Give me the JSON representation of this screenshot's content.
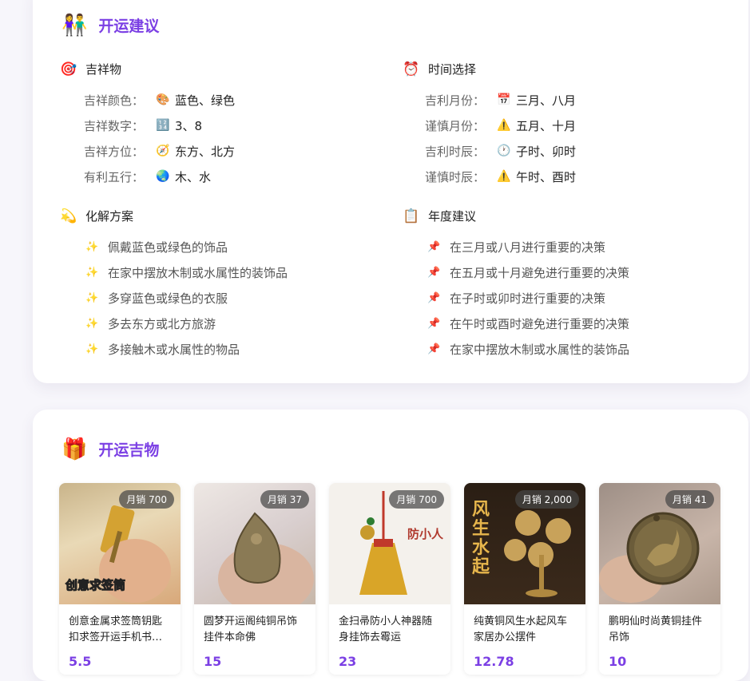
{
  "luck_advice": {
    "title": "开运建议",
    "mascots": {
      "heading": "吉祥物",
      "items": [
        {
          "label": "吉祥颜色：",
          "icon": "palette-icon",
          "value": "蓝色、绿色"
        },
        {
          "label": "吉祥数字：",
          "icon": "numbers-icon",
          "value": "3、8"
        },
        {
          "label": "吉祥方位：",
          "icon": "compass-icon",
          "value": "东方、北方"
        },
        {
          "label": "有利五行：",
          "icon": "globe-icon",
          "value": "木、水"
        }
      ]
    },
    "timing": {
      "heading": "时间选择",
      "items": [
        {
          "label": "吉利月份：",
          "icon": "calendar-icon",
          "value": "三月、八月"
        },
        {
          "label": "谨慎月份：",
          "icon": "warning-icon",
          "value": "五月、十月"
        },
        {
          "label": "吉利时辰：",
          "icon": "clock-icon",
          "value": "子时、卯时"
        },
        {
          "label": "谨慎时辰：",
          "icon": "warning-icon",
          "value": "午时、酉时"
        }
      ]
    },
    "remedies": {
      "heading": "化解方案",
      "items": [
        "佩戴蓝色或绿色的饰品",
        "在家中摆放木制或水属性的装饰品",
        "多穿蓝色或绿色的衣服",
        "多去东方或北方旅游",
        "多接触木或水属性的物品"
      ]
    },
    "yearly": {
      "heading": "年度建议",
      "items": [
        "在三月或八月进行重要的决策",
        "在五月或十月避免进行重要的决策",
        "在子时或卯时进行重要的决策",
        "在午时或酉时避免进行重要的决策",
        "在家中摆放木制或水属性的装饰品"
      ]
    }
  },
  "lucky_items": {
    "title": "开运吉物",
    "products": [
      {
        "sales": "月销 700",
        "name": "创意金属求签筒钥匙扣求签开运手机书…",
        "price": "5.5",
        "thumb_text": "创意求签筒"
      },
      {
        "sales": "月销 37",
        "name": "圆梦开运阁纯铜吊饰挂件本命佛",
        "price": "15",
        "thumb_text": ""
      },
      {
        "sales": "月销 700",
        "name": "金扫帚防小人神器随身挂饰去霉运",
        "price": "23",
        "thumb_text": "防小人"
      },
      {
        "sales": "月销 2,000",
        "name": "纯黄铜风生水起风车家居办公摆件",
        "price": "12.78",
        "thumb_text": "风生水起"
      },
      {
        "sales": "月销 41",
        "name": "鹏明仙时尚黄铜挂件吊饰",
        "price": "10",
        "thumb_text": ""
      }
    ]
  }
}
